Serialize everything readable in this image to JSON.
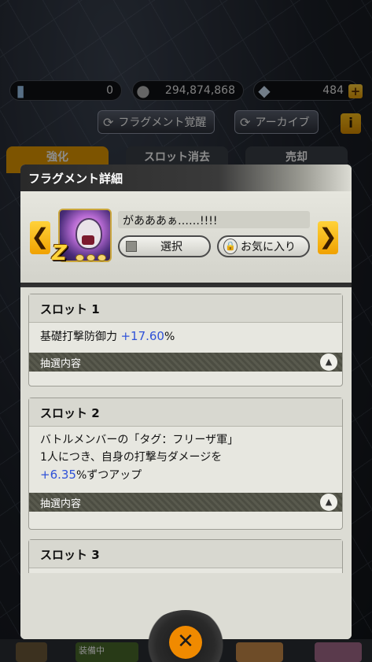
{
  "currencies": {
    "stones": "0",
    "zeni": "294,874,868",
    "crystals": "484",
    "plus": "+"
  },
  "top_buttons": {
    "awaken": "フラグメント覚醒",
    "archive": "アーカイブ",
    "info": "i"
  },
  "tabs": [
    "強化",
    "スロット消去",
    "売却"
  ],
  "bottom": {
    "equipped": "装備中"
  },
  "modal": {
    "title": "フラグメント詳細",
    "character_name": "があああぁ……!!!!",
    "z_badge": "Z",
    "prev": "❮",
    "next": "❯",
    "select_label": "選択",
    "favorite_label": "お気に入り",
    "lock_glyph": "🔒",
    "close_glyph": "✕",
    "lottery_label": "抽選内容",
    "up_glyph": "▲",
    "slots": [
      {
        "title": "スロット 1",
        "text_pre": "基礎打撃防御力 ",
        "value": "+17.60",
        "text_post": "%"
      },
      {
        "title": "スロット 2",
        "line1": "バトルメンバーの「タグ：フリーザ軍」",
        "line2": "1人につき、自身の打撃与ダメージを",
        "value": "+6.35",
        "text_post": "%ずつアップ"
      },
      {
        "title": "スロット 3"
      }
    ]
  },
  "icons": {
    "stone": "stone-icon",
    "zeni": "coin-icon",
    "crystal": "crystal-icon"
  },
  "colors": {
    "accent_orange": "#f0a100",
    "value_blue": "#2f52d8",
    "lottery_bar": "#555649"
  }
}
